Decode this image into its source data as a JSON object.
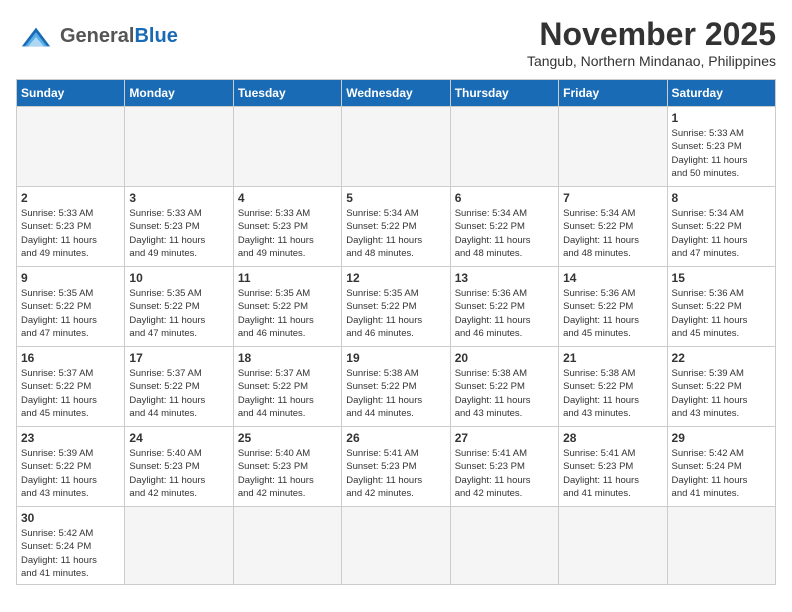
{
  "header": {
    "logo_general": "General",
    "logo_blue": "Blue",
    "title": "November 2025",
    "subtitle": "Tangub, Northern Mindanao, Philippines"
  },
  "weekdays": [
    "Sunday",
    "Monday",
    "Tuesday",
    "Wednesday",
    "Thursday",
    "Friday",
    "Saturday"
  ],
  "weeks": [
    [
      {
        "day": null,
        "info": ""
      },
      {
        "day": null,
        "info": ""
      },
      {
        "day": null,
        "info": ""
      },
      {
        "day": null,
        "info": ""
      },
      {
        "day": null,
        "info": ""
      },
      {
        "day": null,
        "info": ""
      },
      {
        "day": "1",
        "info": "Sunrise: 5:33 AM\nSunset: 5:23 PM\nDaylight: 11 hours\nand 50 minutes."
      }
    ],
    [
      {
        "day": "2",
        "info": "Sunrise: 5:33 AM\nSunset: 5:23 PM\nDaylight: 11 hours\nand 49 minutes."
      },
      {
        "day": "3",
        "info": "Sunrise: 5:33 AM\nSunset: 5:23 PM\nDaylight: 11 hours\nand 49 minutes."
      },
      {
        "day": "4",
        "info": "Sunrise: 5:33 AM\nSunset: 5:23 PM\nDaylight: 11 hours\nand 49 minutes."
      },
      {
        "day": "5",
        "info": "Sunrise: 5:34 AM\nSunset: 5:22 PM\nDaylight: 11 hours\nand 48 minutes."
      },
      {
        "day": "6",
        "info": "Sunrise: 5:34 AM\nSunset: 5:22 PM\nDaylight: 11 hours\nand 48 minutes."
      },
      {
        "day": "7",
        "info": "Sunrise: 5:34 AM\nSunset: 5:22 PM\nDaylight: 11 hours\nand 48 minutes."
      },
      {
        "day": "8",
        "info": "Sunrise: 5:34 AM\nSunset: 5:22 PM\nDaylight: 11 hours\nand 47 minutes."
      }
    ],
    [
      {
        "day": "9",
        "info": "Sunrise: 5:35 AM\nSunset: 5:22 PM\nDaylight: 11 hours\nand 47 minutes."
      },
      {
        "day": "10",
        "info": "Sunrise: 5:35 AM\nSunset: 5:22 PM\nDaylight: 11 hours\nand 47 minutes."
      },
      {
        "day": "11",
        "info": "Sunrise: 5:35 AM\nSunset: 5:22 PM\nDaylight: 11 hours\nand 46 minutes."
      },
      {
        "day": "12",
        "info": "Sunrise: 5:35 AM\nSunset: 5:22 PM\nDaylight: 11 hours\nand 46 minutes."
      },
      {
        "day": "13",
        "info": "Sunrise: 5:36 AM\nSunset: 5:22 PM\nDaylight: 11 hours\nand 46 minutes."
      },
      {
        "day": "14",
        "info": "Sunrise: 5:36 AM\nSunset: 5:22 PM\nDaylight: 11 hours\nand 45 minutes."
      },
      {
        "day": "15",
        "info": "Sunrise: 5:36 AM\nSunset: 5:22 PM\nDaylight: 11 hours\nand 45 minutes."
      }
    ],
    [
      {
        "day": "16",
        "info": "Sunrise: 5:37 AM\nSunset: 5:22 PM\nDaylight: 11 hours\nand 45 minutes."
      },
      {
        "day": "17",
        "info": "Sunrise: 5:37 AM\nSunset: 5:22 PM\nDaylight: 11 hours\nand 44 minutes."
      },
      {
        "day": "18",
        "info": "Sunrise: 5:37 AM\nSunset: 5:22 PM\nDaylight: 11 hours\nand 44 minutes."
      },
      {
        "day": "19",
        "info": "Sunrise: 5:38 AM\nSunset: 5:22 PM\nDaylight: 11 hours\nand 44 minutes."
      },
      {
        "day": "20",
        "info": "Sunrise: 5:38 AM\nSunset: 5:22 PM\nDaylight: 11 hours\nand 43 minutes."
      },
      {
        "day": "21",
        "info": "Sunrise: 5:38 AM\nSunset: 5:22 PM\nDaylight: 11 hours\nand 43 minutes."
      },
      {
        "day": "22",
        "info": "Sunrise: 5:39 AM\nSunset: 5:22 PM\nDaylight: 11 hours\nand 43 minutes."
      }
    ],
    [
      {
        "day": "23",
        "info": "Sunrise: 5:39 AM\nSunset: 5:22 PM\nDaylight: 11 hours\nand 43 minutes."
      },
      {
        "day": "24",
        "info": "Sunrise: 5:40 AM\nSunset: 5:23 PM\nDaylight: 11 hours\nand 42 minutes."
      },
      {
        "day": "25",
        "info": "Sunrise: 5:40 AM\nSunset: 5:23 PM\nDaylight: 11 hours\nand 42 minutes."
      },
      {
        "day": "26",
        "info": "Sunrise: 5:41 AM\nSunset: 5:23 PM\nDaylight: 11 hours\nand 42 minutes."
      },
      {
        "day": "27",
        "info": "Sunrise: 5:41 AM\nSunset: 5:23 PM\nDaylight: 11 hours\nand 42 minutes."
      },
      {
        "day": "28",
        "info": "Sunrise: 5:41 AM\nSunset: 5:23 PM\nDaylight: 11 hours\nand 41 minutes."
      },
      {
        "day": "29",
        "info": "Sunrise: 5:42 AM\nSunset: 5:24 PM\nDaylight: 11 hours\nand 41 minutes."
      }
    ],
    [
      {
        "day": "30",
        "info": "Sunrise: 5:42 AM\nSunset: 5:24 PM\nDaylight: 11 hours\nand 41 minutes."
      },
      {
        "day": null,
        "info": ""
      },
      {
        "day": null,
        "info": ""
      },
      {
        "day": null,
        "info": ""
      },
      {
        "day": null,
        "info": ""
      },
      {
        "day": null,
        "info": ""
      },
      {
        "day": null,
        "info": ""
      }
    ]
  ]
}
